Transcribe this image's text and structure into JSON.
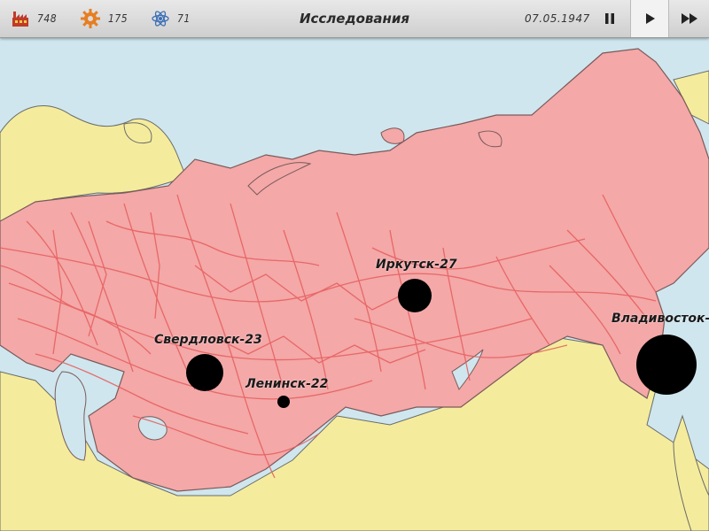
{
  "toolbar": {
    "factories": {
      "icon": "factory-icon",
      "value": "748"
    },
    "gears": {
      "icon": "gear-icon",
      "value": "175"
    },
    "science": {
      "icon": "atom-icon",
      "value": "71"
    },
    "title": "Исследования",
    "date": "07.05.1947",
    "controls": {
      "pause_icon": "pause-icon",
      "play_icon": "play-icon",
      "fast_forward_icon": "fast-forward-icon"
    }
  },
  "cities": [
    {
      "name": "Иркутск-27"
    },
    {
      "name": "Свердловск-23"
    },
    {
      "name": "Ленинск-22"
    },
    {
      "name": "Владивосток-"
    }
  ],
  "colors": {
    "land_ussr": "#f4a8a8",
    "land_other": "#f4ec9c",
    "sea": "#cfe6ee",
    "railways": "#e65c5c",
    "borders": "#7a5a5a"
  }
}
